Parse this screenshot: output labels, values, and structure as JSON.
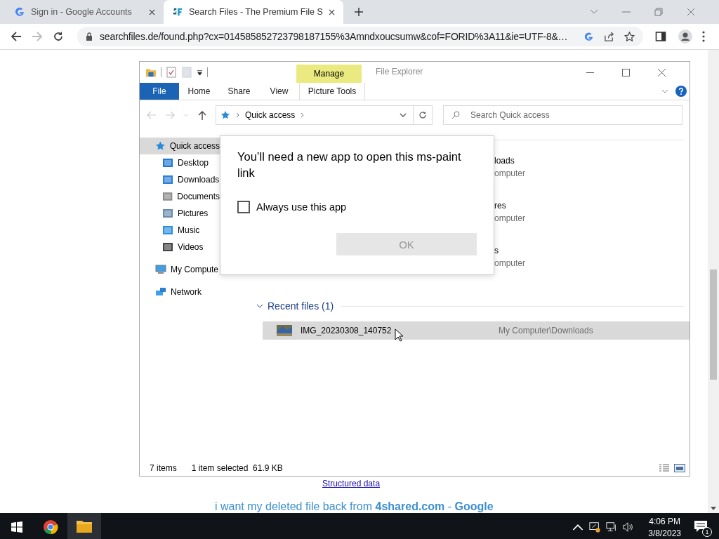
{
  "browser": {
    "tabs": [
      {
        "title": "Sign in - Google Accounts",
        "selected": false
      },
      {
        "title": "Search Files - The Premium File S",
        "selected": true
      }
    ],
    "url": "searchfiles.de/found.php?cx=014585852723798187155%3Amndxoucsumw&cof=FORID%3A11&ie=UTF-8&…",
    "forward_disabled": true
  },
  "page": {
    "link": "Structured data",
    "result_parts": [
      "i want my deleted file back from ",
      "**4shared.com**",
      " - ",
      "**Google**"
    ]
  },
  "explorer": {
    "title": "File Explorer",
    "context_group": "Manage",
    "file_tab": "File",
    "ribbon_tabs": [
      "Home",
      "Share",
      "View"
    ],
    "context_tab": "Picture Tools",
    "address": "Quick access",
    "search": {
      "placeholder": "Search Quick access"
    },
    "nav": [
      {
        "label": "Quick access",
        "selected": true,
        "children": [
          {
            "label": "Desktop",
            "selected": false
          },
          {
            "label": "Downloads",
            "selected": false
          },
          {
            "label": "Documents",
            "selected": false
          },
          {
            "label": "Pictures",
            "selected": false
          },
          {
            "label": "Music",
            "selected": false
          },
          {
            "label": "Videos",
            "selected": false
          }
        ]
      },
      {
        "label": "My Compute",
        "selected": false
      },
      {
        "label": "Network",
        "selected": false
      }
    ],
    "frequent": [
      {
        "name": "loads",
        "location": "omputer"
      },
      {
        "name": "res",
        "location": "omputer"
      },
      {
        "name": "s",
        "location": "omputer"
      }
    ],
    "recent_header": "Recent files (1)",
    "recent_expanded": true,
    "recent": [
      {
        "name": "IMG_20230308_140752",
        "location": "My Computer\\Downloads",
        "selected": true
      }
    ],
    "status": {
      "items": "7 items",
      "selection": "1 item selected  61.9 KB"
    }
  },
  "dialog": {
    "message": "You’ll need a new app to open this ms-paint link",
    "checkbox": {
      "label": "Always use this app",
      "checked": false
    },
    "button": {
      "label": "OK",
      "disabled": true
    }
  },
  "taskbar": {
    "time": "4:06 PM",
    "date": "3/8/2023",
    "notifications": "1"
  }
}
